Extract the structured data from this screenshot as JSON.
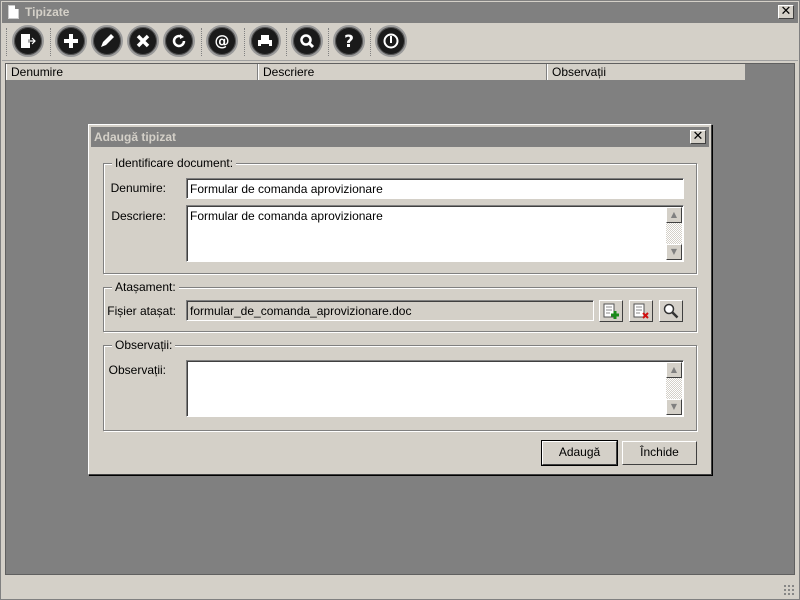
{
  "window": {
    "title": "Tipizate",
    "close_glyph": "✕"
  },
  "toolbar": {
    "buttons": [
      {
        "name": "exit-icon"
      },
      {
        "name": "add-icon"
      },
      {
        "name": "edit-icon"
      },
      {
        "name": "delete-icon"
      },
      {
        "name": "refresh-icon"
      },
      {
        "name": "email-icon"
      },
      {
        "name": "print-icon"
      },
      {
        "name": "search-icon"
      },
      {
        "name": "help-icon"
      },
      {
        "name": "power-icon"
      }
    ]
  },
  "grid": {
    "columns": [
      "Denumire",
      "Descriere",
      "Observații"
    ]
  },
  "dialog": {
    "title": "Adaugă tipizat",
    "close_glyph": "✕",
    "identificare": {
      "legend": "Identificare document:",
      "denumire_label": "Denumire:",
      "denumire_value": "Formular de comanda aprovizionare",
      "descriere_label": "Descriere:",
      "descriere_value": "Formular de comanda aprovizionare"
    },
    "atasament": {
      "legend": "Atașament:",
      "fisier_label": "Fișier atașat:",
      "fisier_value": "formular_de_comanda_aprovizionare.doc"
    },
    "observatii": {
      "legend": "Observații:",
      "label": "Observații:",
      "value": ""
    },
    "buttons": {
      "add": "Adaugă",
      "close": "Închide"
    }
  },
  "colors": {
    "title_bar": "#808080",
    "window_bg": "#d4d0c8",
    "grid_bg": "#808080"
  }
}
